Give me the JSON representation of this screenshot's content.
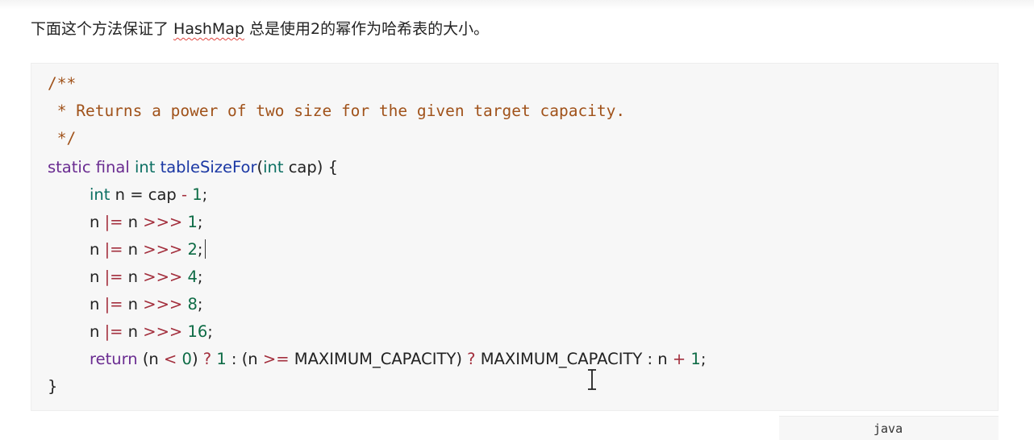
{
  "intro": {
    "before": "下面这个方法保证了 ",
    "hashmap": "HashMap",
    "after": " 总是使用2的幂作为哈希表的大小。"
  },
  "code": {
    "comment_open": "/**",
    "comment_body": " * Returns a power of two size for the given target capacity.",
    "comment_close": " */",
    "sig": {
      "kw": "static final ",
      "type": "int ",
      "name": "tableSizeFor",
      "open": "(",
      "ptype": "int",
      "param": " cap) {"
    },
    "decl": {
      "type": "int",
      "text": " n = cap ",
      "op": "-",
      "num": " 1",
      "semi": ";"
    },
    "shifts": [
      {
        "n": "n ",
        "op1": "|=",
        "mid": " n ",
        "op2": ">>>",
        "num": " 1",
        "semi": ";"
      },
      {
        "n": "n ",
        "op1": "|=",
        "mid": " n ",
        "op2": ">>>",
        "num": " 2",
        "semi": ";"
      },
      {
        "n": "n ",
        "op1": "|=",
        "mid": " n ",
        "op2": ">>>",
        "num": " 4",
        "semi": ";"
      },
      {
        "n": "n ",
        "op1": "|=",
        "mid": " n ",
        "op2": ">>>",
        "num": " 8",
        "semi": ";"
      },
      {
        "n": "n ",
        "op1": "|=",
        "mid": " n ",
        "op2": ">>>",
        "num": " 16",
        "semi": ";"
      }
    ],
    "ret": {
      "kw": "return",
      "p1": " (n ",
      "lt": "<",
      "zero": " 0",
      "p2": ") ",
      "q1": "?",
      "one": " 1",
      "p3": " : (n ",
      "ge": ">=",
      "p4": " MAXIMUM_CAPACITY) ",
      "q2": "?",
      "p5": " MAXIMUM_CAPACITY : n ",
      "plus": "+",
      "one2": " 1",
      "semi": ";"
    },
    "close": "}"
  },
  "lang_label": "java",
  "icons": {
    "cursor": "text-cursor-icon"
  }
}
